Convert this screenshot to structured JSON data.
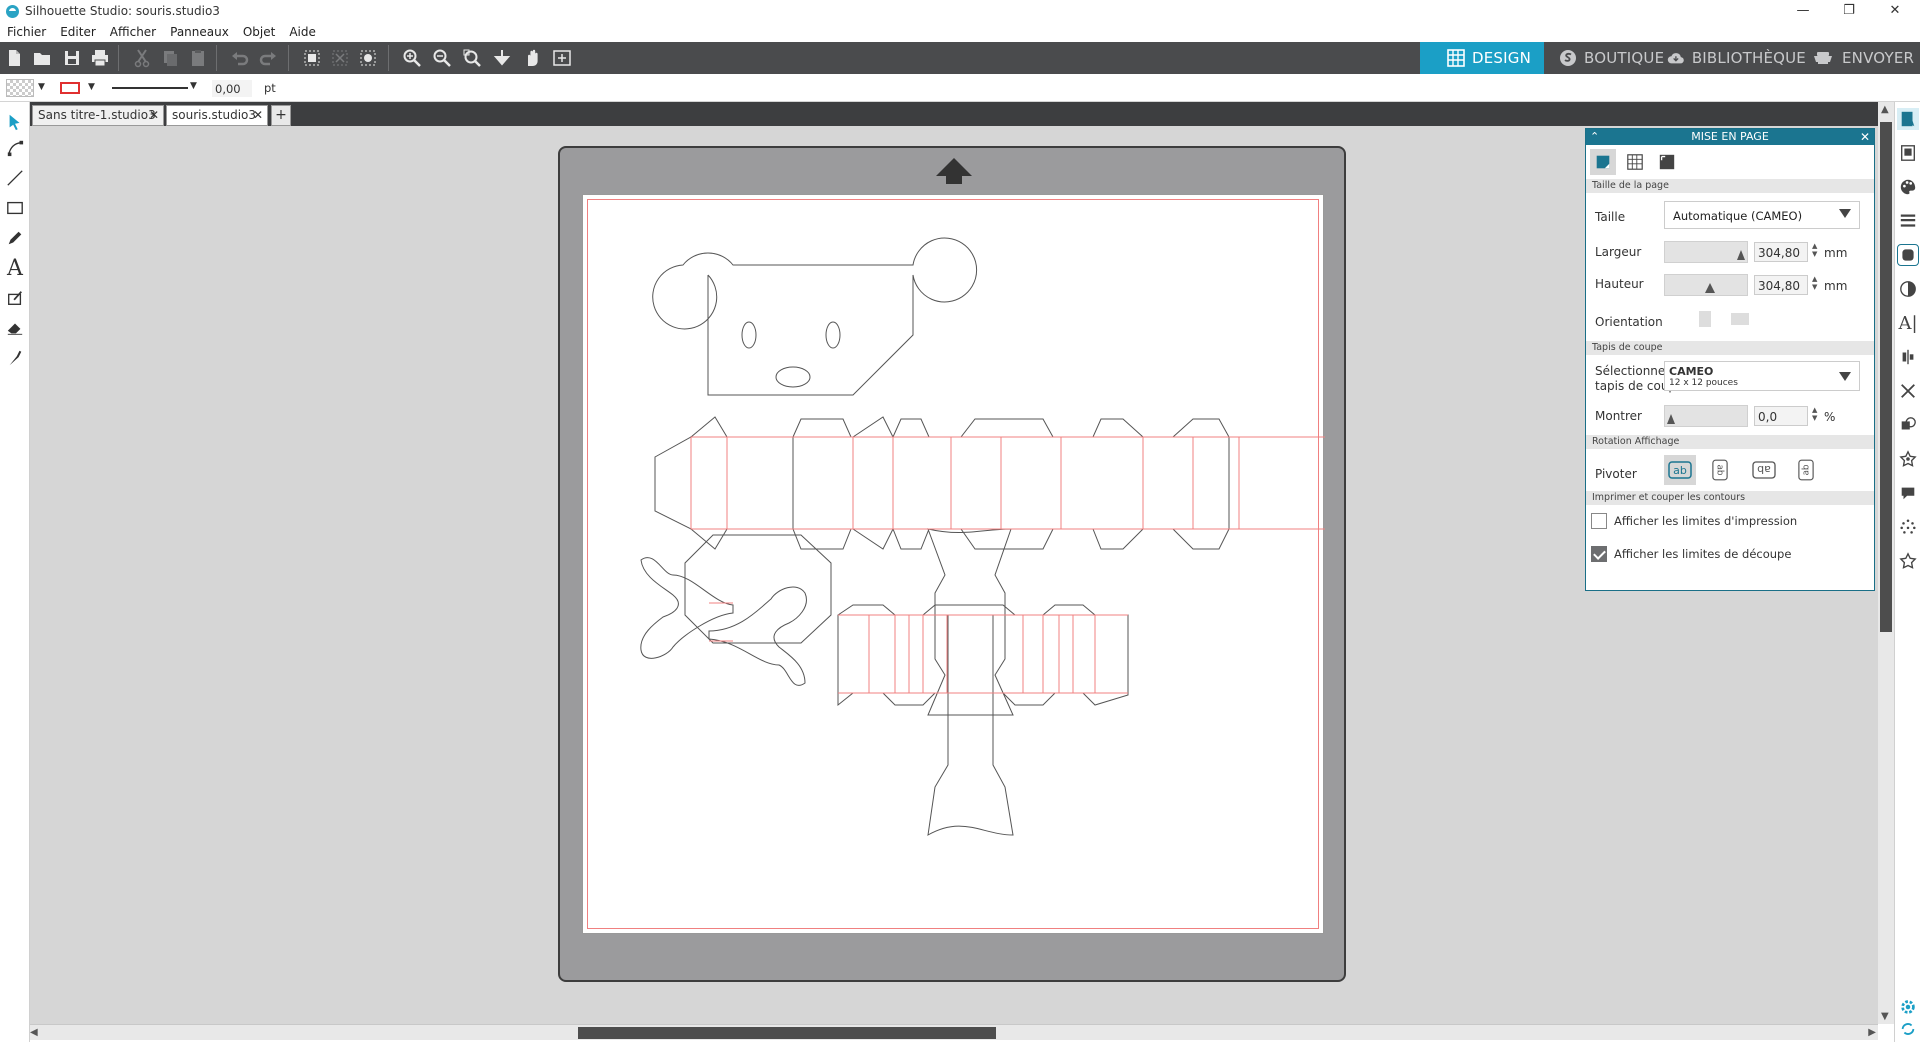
{
  "window": {
    "title": "Silhouette Studio: souris.studio3",
    "controls": {
      "minimize": "—",
      "restore": "❐",
      "close": "✕"
    }
  },
  "menu": [
    "Fichier",
    "Editer",
    "Afficher",
    "Panneaux",
    "Objet",
    "Aide"
  ],
  "nav_tabs": [
    {
      "label": "DESIGN",
      "icon": "grid-icon",
      "active": true
    },
    {
      "label": "BOUTIQUE",
      "icon": "silhouette-s-icon",
      "active": false
    },
    {
      "label": "BIBLIOTHÈQUE",
      "icon": "cloud-library-icon",
      "active": false
    },
    {
      "label": "ENVOYER",
      "icon": "cutter-icon",
      "active": false
    }
  ],
  "propbar": {
    "line_width": "0,00",
    "line_unit": "pt"
  },
  "doc_tabs": [
    {
      "label": "Sans titre-1.studio3",
      "active": false
    },
    {
      "label": "souris.studio3",
      "active": true
    }
  ],
  "add_tab": "+",
  "panel": {
    "title": "MISE EN PAGE",
    "sections": {
      "page_size": "Taille de la page",
      "cutting_mat": "Tapis de coupe",
      "rotation": "Rotation Affichage",
      "print_cut": "Imprimer et couper les contours"
    },
    "size_label": "Taille",
    "size_value": "Automatique (CAMEO)",
    "width_label": "Largeur",
    "width_value": "304,80",
    "height_label": "Hauteur",
    "height_value": "304,80",
    "unit_mm": "mm",
    "orientation_label": "Orientation",
    "mat_label_1": "Sélectionner le",
    "mat_label_2": "tapis de coupe",
    "mat_value": "CAMEO",
    "mat_sub": "12 x 12 pouces",
    "show_label": "Montrer",
    "show_value": "0,0",
    "show_unit": "%",
    "rotate_label": "Pivoter",
    "check_print": {
      "label": "Afficher les limites d'impression",
      "checked": false
    },
    "check_cut": {
      "label": "Afficher les limites de découpe",
      "checked": true
    }
  },
  "colors": {
    "toolbar": "#4a4b4d",
    "accent": "#1b9fc6",
    "cut_line": "#f08080",
    "canvas": "#d6d6d6",
    "mat": "#9b9b9d"
  }
}
